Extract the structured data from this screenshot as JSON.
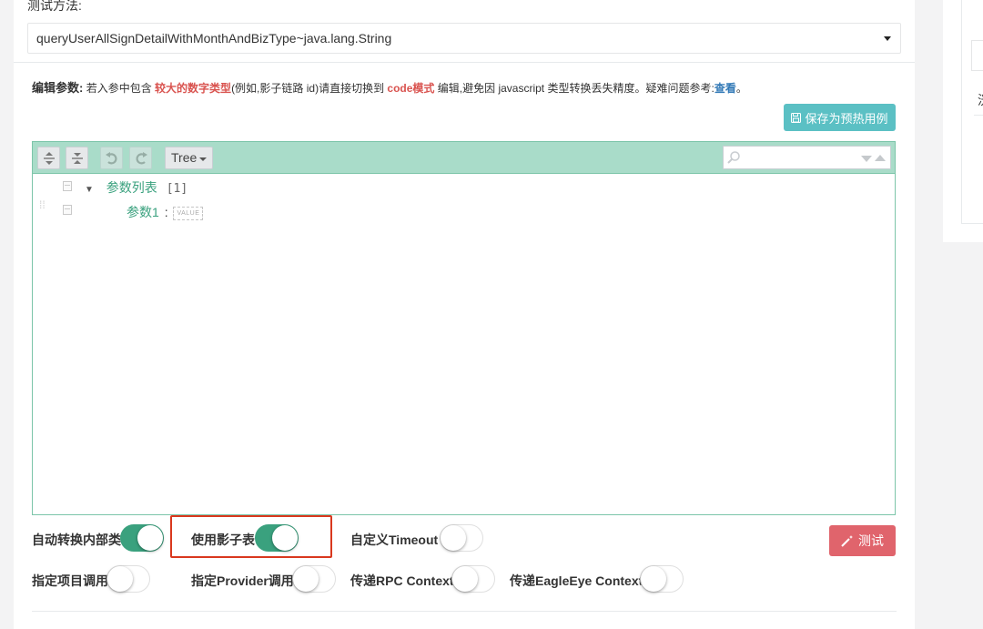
{
  "form": {
    "method_label": "测试方法:",
    "method_value": "queryUserAllSignDetailWithMonthAndBizType~java.lang.String"
  },
  "hint": {
    "label": "编辑参数:",
    "text1": "若入参中包含",
    "highlight1": "较大的数字类型",
    "text2": "(例如,影子链路 id)请直接切换到",
    "highlight2": "code模式",
    "text3": "编辑,避免因 javascript 类型转换丢失精度。疑难问题参考:",
    "link": "查看",
    "end": "。"
  },
  "save_button": {
    "label": "保存为预热用例",
    "icon": "floppy-icon"
  },
  "editor": {
    "mode": "Tree",
    "root_key": "参数列表",
    "root_count": "[1]",
    "child_key": "参数1",
    "child_colon": ":",
    "child_value_placeholder": "VALUE"
  },
  "options": [
    {
      "label": "自动转换内部类",
      "on": true
    },
    {
      "label": "使用影子表",
      "on": true
    },
    {
      "label": "自定义Timeout",
      "on": false
    },
    {
      "label": "指定项目调用",
      "on": false
    },
    {
      "label": "指定Provider调用",
      "on": false
    },
    {
      "label": "传递RPC Context",
      "on": false
    },
    {
      "label": "传递EagleEye Context",
      "on": false
    }
  ],
  "test_button": {
    "label": "测试",
    "icon": "magic-wand-icon"
  },
  "right_panel": {
    "partial_char": "洸"
  },
  "colors": {
    "accent_green": "#3aa17e",
    "toolbar_bg": "#a9dcc9",
    "save_btn": "#5bc0c4",
    "test_btn": "#e0646c",
    "highlight_red": "#d9381e",
    "hint_red": "#d9534f",
    "link_blue": "#337ab7"
  }
}
